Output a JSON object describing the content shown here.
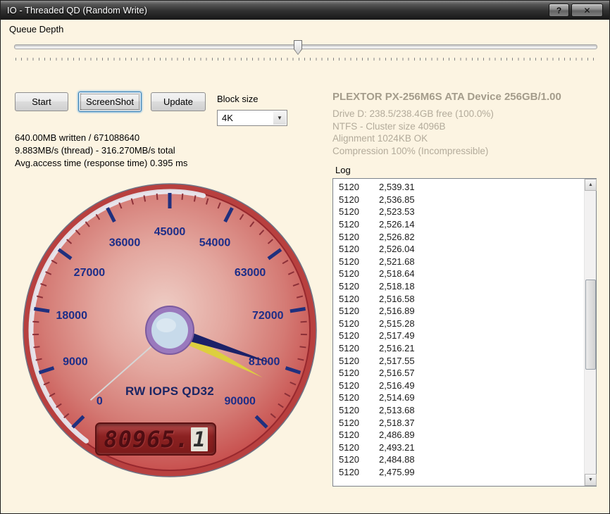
{
  "window": {
    "title": "IO - Threaded QD (Random Write)",
    "help_button": "?",
    "close_button": "✕"
  },
  "queue_depth": {
    "label": "Queue Depth"
  },
  "controls": {
    "start": "Start",
    "screenshot": "ScreenShot",
    "update": "Update",
    "block_size_label": "Block size",
    "block_size_value": "4K",
    "dropdown_arrow": "▼"
  },
  "stats": {
    "written": "640.00MB written / 671088640",
    "speed": "9.883MB/s (thread) - 316.270MB/s total",
    "access_time": "Avg.access time (response time) 0.395 ms"
  },
  "drive": {
    "title": "PLEXTOR PX-256M6S ATA Device 256GB/1.00",
    "lines": [
      "Drive D: 238.5/238.4GB free (100.0%)",
      "NTFS - Cluster size 4096B",
      "Alignment 1024KB OK",
      "Compression 100% (Incompressible)"
    ]
  },
  "log": {
    "label": "Log",
    "rows": [
      [
        "5120",
        "2,539.31"
      ],
      [
        "5120",
        "2,536.85"
      ],
      [
        "5120",
        "2,523.53"
      ],
      [
        "5120",
        "2,526.14"
      ],
      [
        "5120",
        "2,526.82"
      ],
      [
        "5120",
        "2,526.04"
      ],
      [
        "5120",
        "2,521.68"
      ],
      [
        "5120",
        "2,518.64"
      ],
      [
        "5120",
        "2,518.18"
      ],
      [
        "5120",
        "2,516.58"
      ],
      [
        "5120",
        "2,516.89"
      ],
      [
        "5120",
        "2,515.28"
      ],
      [
        "5120",
        "2,517.49"
      ],
      [
        "5120",
        "2,516.21"
      ],
      [
        "5120",
        "2,517.55"
      ],
      [
        "5120",
        "2,516.57"
      ],
      [
        "5120",
        "2,516.49"
      ],
      [
        "5120",
        "2,514.69"
      ],
      [
        "5120",
        "2,513.68"
      ],
      [
        "5120",
        "2,518.37"
      ],
      [
        "5120",
        "2,486.89"
      ],
      [
        "5120",
        "2,493.21"
      ],
      [
        "5120",
        "2,484.88"
      ],
      [
        "5120",
        "2,475.99"
      ]
    ]
  },
  "scrollbar": {
    "up": "▲",
    "down": "▼"
  },
  "chart_data": {
    "type": "gauge",
    "title": "RW IOPS QD32",
    "min": 0,
    "max": 90000,
    "major_tick": 9000,
    "minor_tick": 1800,
    "tick_labels": [
      "0",
      "9000",
      "18000",
      "27000",
      "36000",
      "45000",
      "54000",
      "63000",
      "72000",
      "81000",
      "90000"
    ],
    "value": 80965.1,
    "display_main": "80965.",
    "display_last": "1",
    "peak_value": 84000,
    "floor_value": 1200,
    "start_angle_deg": 225,
    "sweep_deg": 270,
    "colors": {
      "tick_major": "#20307e",
      "tick_minor": "#8c3038",
      "label": "#1c2d88",
      "needle": "#1b2168",
      "needle_peak": "#ddcf3e",
      "needle_floor": "#d6d6d6"
    }
  }
}
